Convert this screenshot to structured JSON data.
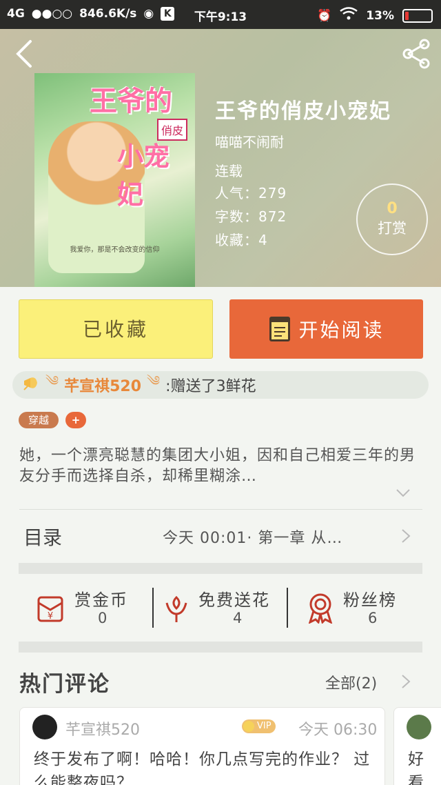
{
  "status_bar": {
    "network": "4G",
    "speed": "846.6K/s",
    "app_badge": "K",
    "time": "下午9:13",
    "battery": "13%",
    "battery_level": 0.13
  },
  "book": {
    "title": "王爷的俏皮小宠妃",
    "author": "喵喵不闹耐",
    "status": "连载",
    "popularity_label": "人气：",
    "popularity": "279",
    "word_count_label": "字数：",
    "word_count": "872",
    "favorites_label": "收藏：",
    "favorites": "4"
  },
  "cover": {
    "title": "王爷的",
    "badge": "俏皮",
    "subtitle": "小宠妃",
    "quote": "我爱你，那是不会改变的信仰"
  },
  "tip": {
    "count": "0",
    "label": "打赏"
  },
  "actions": {
    "collected_label": "已收藏",
    "read_label": "开始阅读"
  },
  "gift_banner": {
    "user": "芊宣祺520",
    "text": ":赠送了3鲜花"
  },
  "tags": [
    "穿越",
    "+"
  ],
  "synopsis": "她，一个漂亮聪慧的集团大小姐，因和自己相爱三年的男友分手而选择自杀，却稀里糊涂…",
  "toc": {
    "label": "目录",
    "latest": "今天 00:01· 第一章  从…"
  },
  "stats": [
    {
      "label": "赏金币",
      "value": "0",
      "icon": "red-envelope-icon"
    },
    {
      "label": "免费送花",
      "value": "4",
      "icon": "flower-icon"
    },
    {
      "label": "粉丝榜",
      "value": "6",
      "icon": "medal-icon"
    }
  ],
  "comments_section": {
    "title": "热门评论",
    "all_label": "全部(2)",
    "items": [
      {
        "user": "芊宣祺520",
        "vip": "VIP",
        "time": "今天 06:30",
        "text": "终于发布了啊！哈哈！你几点写完的作业？ 过么能整夜吗？"
      },
      {
        "text": "好看"
      }
    ]
  },
  "colors": {
    "accent_orange": "#e8683a",
    "collected_yellow": "#fbf07a",
    "tag_brown": "#c97a4e",
    "gift_user_orange": "#e8883a"
  }
}
